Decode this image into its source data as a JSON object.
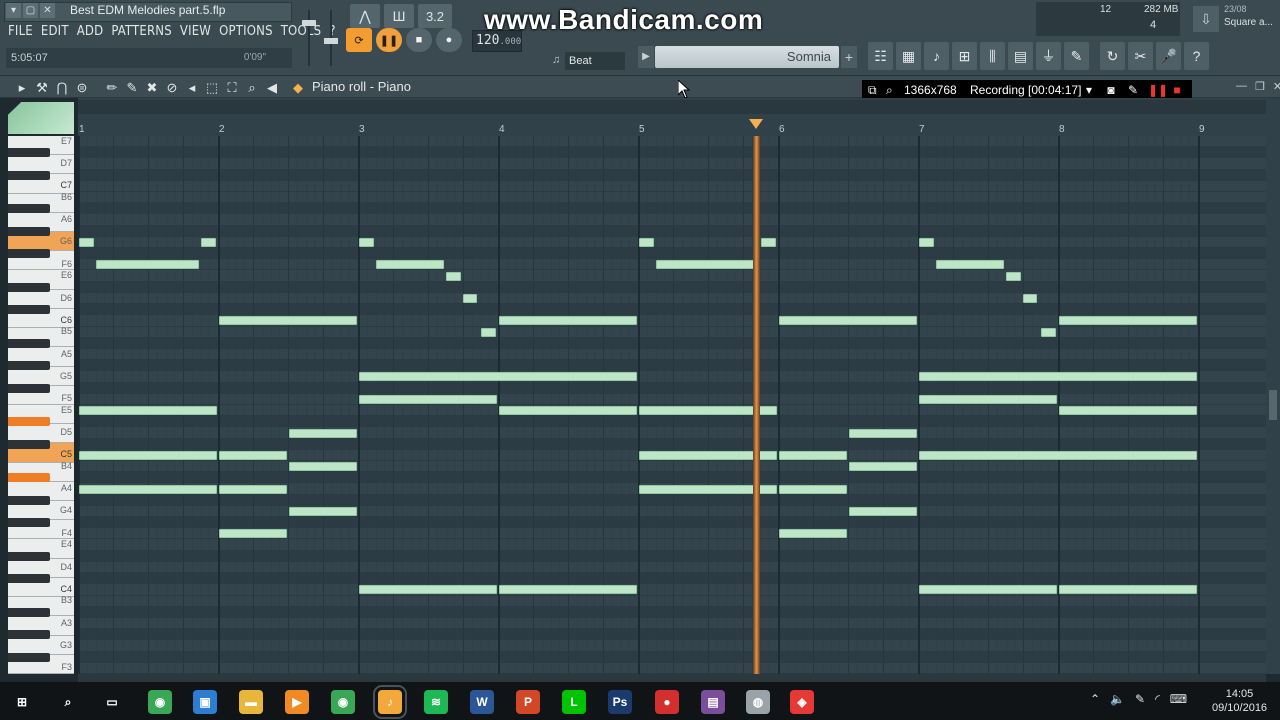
{
  "window": {
    "title": "Best EDM Melodies part.5.flp",
    "controls": [
      "▾",
      "▢",
      "✕"
    ]
  },
  "menu": [
    "FILE",
    "EDIT",
    "ADD",
    "PATTERNS",
    "VIEW",
    "OPTIONS",
    "TOOLS",
    "?"
  ],
  "hint": {
    "time": "5:05:07",
    "elapsed": "0'09\""
  },
  "transport": {
    "tempo_int": "120",
    "tempo_frac": ".000",
    "mode": "Beat"
  },
  "song": {
    "name": "Somnia"
  },
  "monitor": {
    "cpu": "12",
    "memory": "282 MB",
    "polyphony": "4",
    "news_date": "23/08",
    "news_text": "Square a..."
  },
  "watermark": "www.Bandicam.com",
  "piano_roll": {
    "title": "Piano roll - Piano",
    "bar_labels": [
      "1",
      "2",
      "3",
      "4",
      "5",
      "6",
      "7",
      "8",
      "9"
    ],
    "key_labels": {
      "E7": "E7",
      "D7": "D7",
      "C7": "C7",
      "B6": "B6",
      "A6": "A6",
      "G6": "G6",
      "F6": "F6",
      "E6": "E6",
      "D6": "D6",
      "C6": "C6",
      "B5": "B5",
      "A5": "A5",
      "G5": "G5",
      "F5": "F5",
      "E5": "E5",
      "D5": "D5",
      "C5": "C5",
      "B4": "B4",
      "A4": "A4",
      "G4": "G4",
      "F4": "F4",
      "E4": "E4",
      "D4": "D4",
      "C4": "C4",
      "B3": "B3",
      "A3": "A3",
      "G3": "G3",
      "F3": "F3"
    },
    "highlighted_keys": [
      "G6",
      "C5"
    ],
    "highlighted_black_keys": [
      "D#5",
      "A#4"
    ],
    "playhead_bar": 5.84,
    "notes": [
      {
        "pitch": "G6",
        "start": 1.0,
        "len": 0.12
      },
      {
        "pitch": "G6",
        "start": 1.87,
        "len": 0.12
      },
      {
        "pitch": "F6",
        "start": 1.12,
        "len": 0.75
      },
      {
        "pitch": "C6",
        "start": 2.0,
        "len": 1.0
      },
      {
        "pitch": "E5",
        "start": 1.0,
        "len": 1.0
      },
      {
        "pitch": "C5",
        "start": 1.0,
        "len": 1.0
      },
      {
        "pitch": "C5",
        "start": 2.0,
        "len": 0.5
      },
      {
        "pitch": "A4",
        "start": 1.0,
        "len": 1.0
      },
      {
        "pitch": "A4",
        "start": 2.0,
        "len": 0.5
      },
      {
        "pitch": "F4",
        "start": 2.0,
        "len": 0.5
      },
      {
        "pitch": "D5",
        "start": 2.5,
        "len": 0.5
      },
      {
        "pitch": "B4",
        "start": 2.5,
        "len": 0.5
      },
      {
        "pitch": "G4",
        "start": 2.5,
        "len": 0.5
      },
      {
        "pitch": "G6",
        "start": 3.0,
        "len": 0.12
      },
      {
        "pitch": "F6",
        "start": 3.12,
        "len": 0.5
      },
      {
        "pitch": "E6",
        "start": 3.62,
        "len": 0.12
      },
      {
        "pitch": "D6",
        "start": 3.74,
        "len": 0.12
      },
      {
        "pitch": "B5",
        "start": 3.87,
        "len": 0.12
      },
      {
        "pitch": "C6",
        "start": 4.0,
        "len": 1.0
      },
      {
        "pitch": "G5",
        "start": 3.0,
        "len": 2.0
      },
      {
        "pitch": "F5",
        "start": 3.0,
        "len": 1.0
      },
      {
        "pitch": "E5",
        "start": 4.0,
        "len": 1.0
      },
      {
        "pitch": "C4",
        "start": 3.0,
        "len": 1.0
      },
      {
        "pitch": "C4",
        "start": 4.0,
        "len": 1.0
      },
      {
        "pitch": "G6",
        "start": 5.0,
        "len": 0.12
      },
      {
        "pitch": "F6",
        "start": 5.12,
        "len": 0.75
      },
      {
        "pitch": "G6",
        "start": 5.87,
        "len": 0.12
      },
      {
        "pitch": "E5",
        "start": 5.0,
        "len": 1.0
      },
      {
        "pitch": "C5",
        "start": 5.0,
        "len": 1.0
      },
      {
        "pitch": "C5",
        "start": 6.0,
        "len": 0.5
      },
      {
        "pitch": "A4",
        "start": 5.0,
        "len": 1.0
      },
      {
        "pitch": "A4",
        "start": 6.0,
        "len": 0.5
      },
      {
        "pitch": "F4",
        "start": 6.0,
        "len": 0.5
      },
      {
        "pitch": "C6",
        "start": 6.0,
        "len": 1.0
      },
      {
        "pitch": "D5",
        "start": 6.5,
        "len": 0.5
      },
      {
        "pitch": "B4",
        "start": 6.5,
        "len": 0.5
      },
      {
        "pitch": "G4",
        "start": 6.5,
        "len": 0.5
      },
      {
        "pitch": "G6",
        "start": 7.0,
        "len": 0.12
      },
      {
        "pitch": "F6",
        "start": 7.12,
        "len": 0.5
      },
      {
        "pitch": "E6",
        "start": 7.62,
        "len": 0.12
      },
      {
        "pitch": "D6",
        "start": 7.74,
        "len": 0.12
      },
      {
        "pitch": "B5",
        "start": 7.87,
        "len": 0.12
      },
      {
        "pitch": "C6",
        "start": 8.0,
        "len": 1.0
      },
      {
        "pitch": "G5",
        "start": 7.0,
        "len": 2.0
      },
      {
        "pitch": "F5",
        "start": 7.0,
        "len": 1.0
      },
      {
        "pitch": "E5",
        "start": 8.0,
        "len": 1.0
      },
      {
        "pitch": "C5",
        "start": 7.0,
        "len": 2.0
      },
      {
        "pitch": "C4",
        "start": 7.0,
        "len": 1.0
      },
      {
        "pitch": "C4",
        "start": 8.0,
        "len": 1.0
      }
    ]
  },
  "recording": {
    "resolution": "1366x768",
    "status": "Recording [00:04:17]"
  },
  "taskbar": {
    "time": "14:05",
    "date": "09/10/2016",
    "apps": [
      "start-icon",
      "search-icon",
      "task-view-icon",
      "chrome-icon",
      "store-icon",
      "explorer-icon",
      "media-icon",
      "chrome2-icon",
      "fl-studio-icon",
      "spotify-icon",
      "word-icon",
      "powerpoint-icon",
      "line-icon",
      "photoshop-icon",
      "bandicam-icon",
      "app-icon",
      "steam-icon",
      "app2-icon"
    ]
  },
  "colors": {
    "note": "#bfe5c8",
    "playhead": "#e8934a",
    "accent": "#f39c31"
  }
}
